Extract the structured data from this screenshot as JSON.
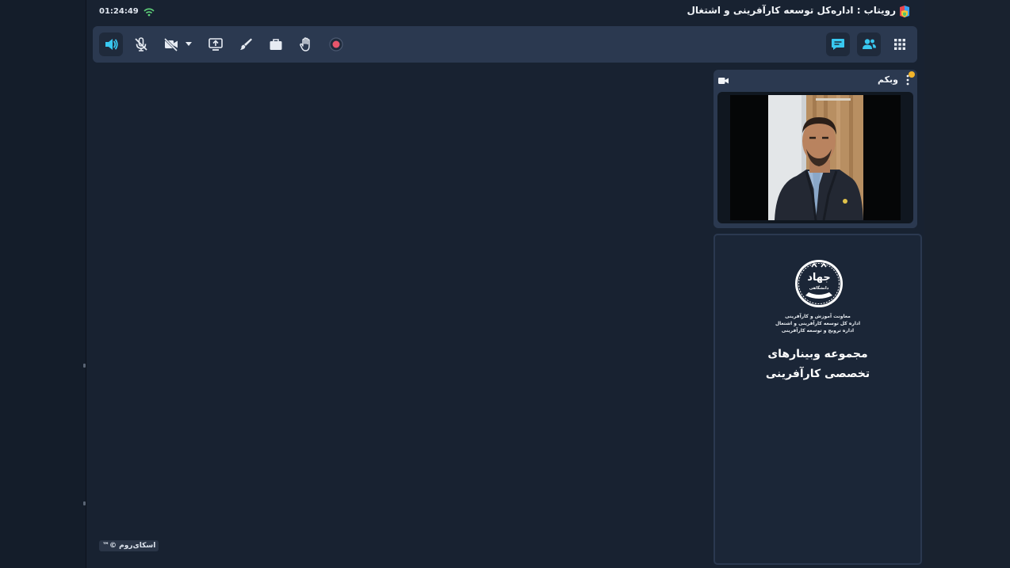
{
  "topbar": {
    "clock": "01:24:49",
    "room_title": "رویتاب : اداره‌کل توسعه کارآفرینی و اشتغال"
  },
  "toolbar": {
    "left_buttons": [
      "speaker-icon",
      "mic-muted-icon",
      "camera-off-icon",
      "share-screen-icon",
      "whiteboard-brush-icon",
      "briefcase-icon",
      "raise-hand-icon",
      "record-icon"
    ],
    "right_buttons": [
      "chat-icon",
      "users-icon",
      "apps-grid-icon"
    ],
    "accent_color": "#38c8f0",
    "record_color": "#e8556b"
  },
  "webcam": {
    "title": "وبکم",
    "status_color": "#f3b52b"
  },
  "slide": {
    "emblem_text": "جهاد",
    "emblem_subtext": "دانشگاهی",
    "org_lines": [
      "معاونت آموزش و کارآفرینی",
      "اداره کل توسعه کارآفرینی و اشتغال",
      "اداره ترویج و توسعه کارآفرینی"
    ],
    "title_lines": [
      "مجموعه وبینارهای",
      "تخصصی کارآفرینی"
    ]
  },
  "watermark": "اسکای‌روم ©™"
}
